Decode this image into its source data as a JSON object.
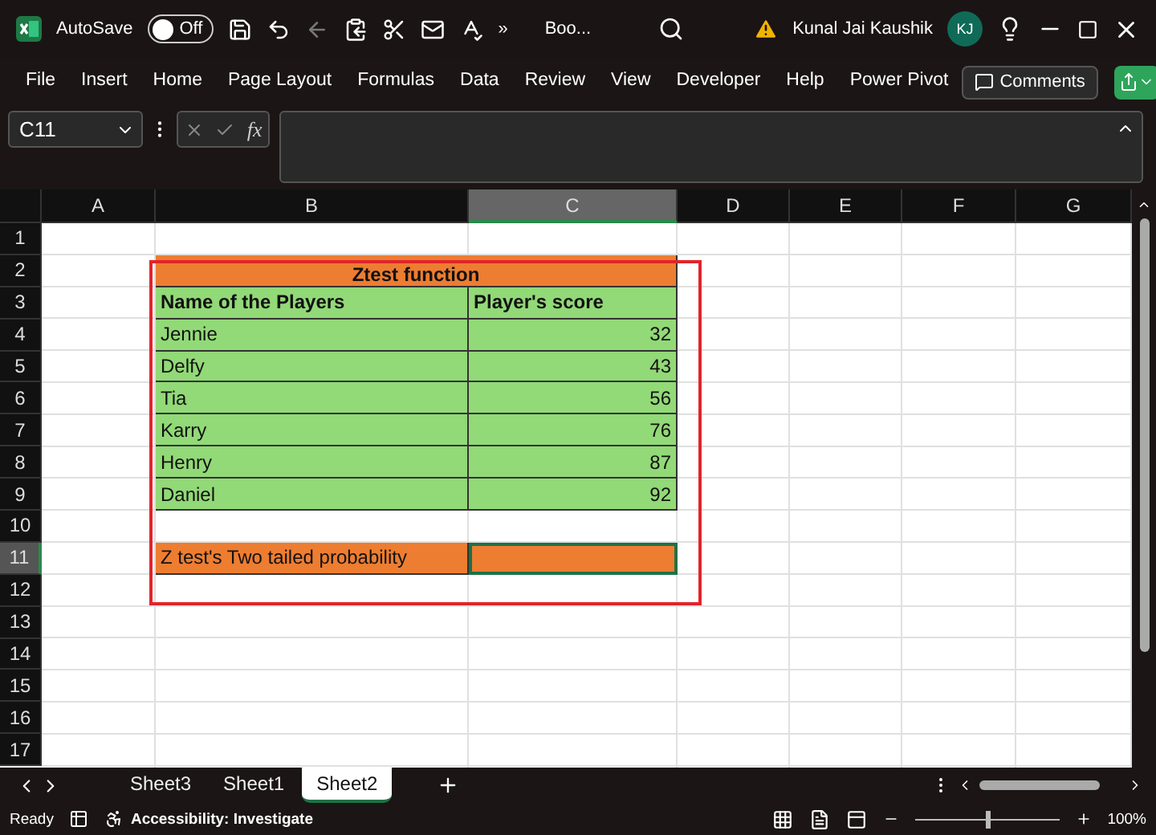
{
  "title_bar": {
    "autosave_label": "AutoSave",
    "autosave": {
      "on": false,
      "label": "Off"
    },
    "overflow": "»",
    "file_name": "Boo...",
    "user_name": "Kunal Jai Kaushik",
    "avatar": "KJ"
  },
  "ribbon_tabs": [
    {
      "label": "File",
      "selected": false
    },
    {
      "label": "Insert",
      "selected": false
    },
    {
      "label": "Home",
      "selected": false
    },
    {
      "label": "Page Layout",
      "selected": false
    },
    {
      "label": "Formulas",
      "selected": false
    },
    {
      "label": "Data",
      "selected": false
    },
    {
      "label": "Review",
      "selected": false
    },
    {
      "label": "View",
      "selected": false
    },
    {
      "label": "Developer",
      "selected": false
    },
    {
      "label": "Help",
      "selected": false
    },
    {
      "label": "Power Pivot",
      "selected": false
    }
  ],
  "comments_button": "Comments",
  "formula_bar": {
    "name_box": "C11",
    "fx": "fx"
  },
  "sheet": {
    "columns": [
      {
        "label": "A",
        "selected": false
      },
      {
        "label": "B",
        "selected": false
      },
      {
        "label": "C",
        "selected": true
      },
      {
        "label": "D",
        "selected": false
      },
      {
        "label": "E",
        "selected": false
      },
      {
        "label": "F",
        "selected": false
      },
      {
        "label": "G",
        "selected": false
      }
    ],
    "rows": [
      {
        "label": "1",
        "selected": false,
        "cells": []
      },
      {
        "label": "2",
        "selected": false,
        "cells": [
          "",
          {
            "text": "Ztest function",
            "kind": "title",
            "color": "#ed7d31",
            "selected": false
          }
        ]
      },
      {
        "label": "3",
        "selected": false,
        "cells": [
          "",
          {
            "text": "Name of the Players",
            "kind": "header",
            "color": "#92d977",
            "selected": false
          },
          {
            "text": "Player's score",
            "kind": "header",
            "color": "#92d977",
            "selected": false
          }
        ]
      },
      {
        "label": "4",
        "selected": false,
        "cells": [
          "",
          {
            "text": "Jennie",
            "kind": "text",
            "color": "#92d977",
            "selected": false
          },
          {
            "text": "32",
            "kind": "number",
            "color": "#92d977",
            "selected": false
          }
        ]
      },
      {
        "label": "5",
        "selected": false,
        "cells": [
          "",
          {
            "text": "Delfy",
            "kind": "text",
            "color": "#92d977",
            "selected": false
          },
          {
            "text": "43",
            "kind": "number",
            "color": "#92d977",
            "selected": false
          }
        ]
      },
      {
        "label": "6",
        "selected": false,
        "cells": [
          "",
          {
            "text": "Tia",
            "kind": "text",
            "color": "#92d977",
            "selected": false
          },
          {
            "text": "56",
            "kind": "number",
            "color": "#92d977",
            "selected": false
          }
        ]
      },
      {
        "label": "7",
        "selected": false,
        "cells": [
          "",
          {
            "text": "Karry",
            "kind": "text",
            "color": "#92d977",
            "selected": false
          },
          {
            "text": "76",
            "kind": "number",
            "color": "#92d977",
            "selected": false
          }
        ]
      },
      {
        "label": "8",
        "selected": false,
        "cells": [
          "",
          {
            "text": "Henry",
            "kind": "text",
            "color": "#92d977",
            "selected": false
          },
          {
            "text": "87",
            "kind": "number",
            "color": "#92d977",
            "selected": false
          }
        ]
      },
      {
        "label": "9",
        "selected": false,
        "cells": [
          "",
          {
            "text": "Daniel",
            "kind": "text",
            "color": "#92d977",
            "selected": false
          },
          {
            "text": "92",
            "kind": "number",
            "color": "#92d977",
            "selected": false
          }
        ]
      },
      {
        "label": "10",
        "selected": false,
        "cells": []
      },
      {
        "label": "11",
        "selected": true,
        "cells": [
          "",
          {
            "text": "Z test's Two tailed probability",
            "kind": "text",
            "color": "#ed7d31",
            "selected": false
          },
          {
            "kind": "fill",
            "color": "#ed7d31",
            "selected": true
          }
        ]
      },
      {
        "label": "12",
        "selected": false,
        "cells": []
      },
      {
        "label": "13",
        "selected": false,
        "cells": []
      },
      {
        "label": "14",
        "selected": false,
        "cells": []
      },
      {
        "label": "15",
        "selected": false,
        "cells": []
      },
      {
        "label": "16",
        "selected": false,
        "cells": []
      },
      {
        "label": "17",
        "selected": false,
        "cells": []
      }
    ]
  },
  "sheet_tabs": [
    {
      "label": "Sheet3",
      "selected": false
    },
    {
      "label": "Sheet1",
      "selected": false
    },
    {
      "label": "Sheet2",
      "selected": true
    }
  ],
  "status_bar": {
    "status": "Ready",
    "accessibility": "Accessibility: Investigate",
    "zoom": "100%",
    "zoom_slider": {
      "level": 0.5
    }
  }
}
